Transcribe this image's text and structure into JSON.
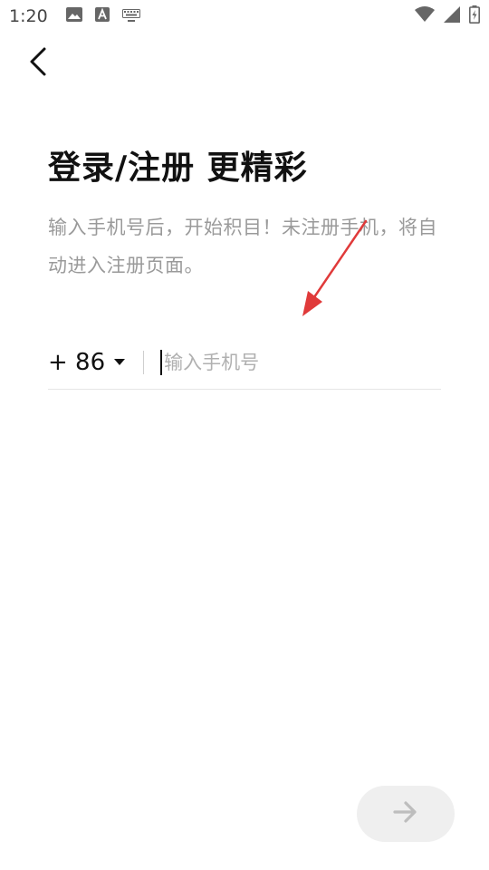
{
  "status_bar": {
    "time": "1:20",
    "icons_left": [
      "image-icon",
      "text-a-icon",
      "keyboard-icon"
    ],
    "icons_right": [
      "wifi-icon",
      "signal-icon",
      "battery-charging-icon"
    ]
  },
  "nav": {
    "back_icon": "chevron-left-icon"
  },
  "header": {
    "title": "登录/注册 更精彩",
    "subtitle": "输入手机号后，开始积目！未注册手机，将自动进入注册页面。"
  },
  "phone": {
    "country_code": "+ 86",
    "placeholder": "输入手机号",
    "value": ""
  },
  "annotation": {
    "color": "#e03a3a"
  },
  "actions": {
    "next_icon": "arrow-right-icon"
  },
  "colors": {
    "background": "#ffffff",
    "title": "#111111",
    "subtitle": "#9a9a9a",
    "next_button_bg": "#efefef",
    "next_button_icon": "#bdbdbd"
  }
}
